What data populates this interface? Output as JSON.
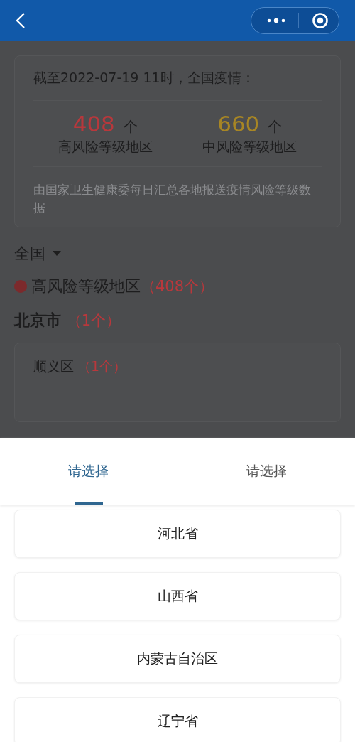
{
  "summary": {
    "title": "截至2022-07-19 11时，全国疫情：",
    "stats": [
      {
        "kind": "high",
        "value": "408",
        "unit": "个",
        "label": "高风险等级地区"
      },
      {
        "kind": "medium",
        "value": "660",
        "unit": "个",
        "label": "中风险等级地区"
      }
    ],
    "note": "由国家卫生健康委每日汇总各地报送疫情风险等级数据"
  },
  "scope": {
    "label": "全国"
  },
  "risk_level": {
    "label": "高风险等级地区",
    "count": "（408个）",
    "color": "#7c2a2c"
  },
  "cities": [
    {
      "name": "北京市",
      "count": "（1个）",
      "districts": [
        {
          "name": "顺义区",
          "count": "（1个）"
        }
      ]
    }
  ],
  "picker": {
    "tabs": [
      {
        "label": "请选择",
        "selected": true
      },
      {
        "label": "请选择",
        "selected": false
      }
    ],
    "options": [
      {
        "label": "河北省"
      },
      {
        "label": "山西省"
      },
      {
        "label": "内蒙古自治区"
      },
      {
        "label": "辽宁省"
      }
    ]
  }
}
